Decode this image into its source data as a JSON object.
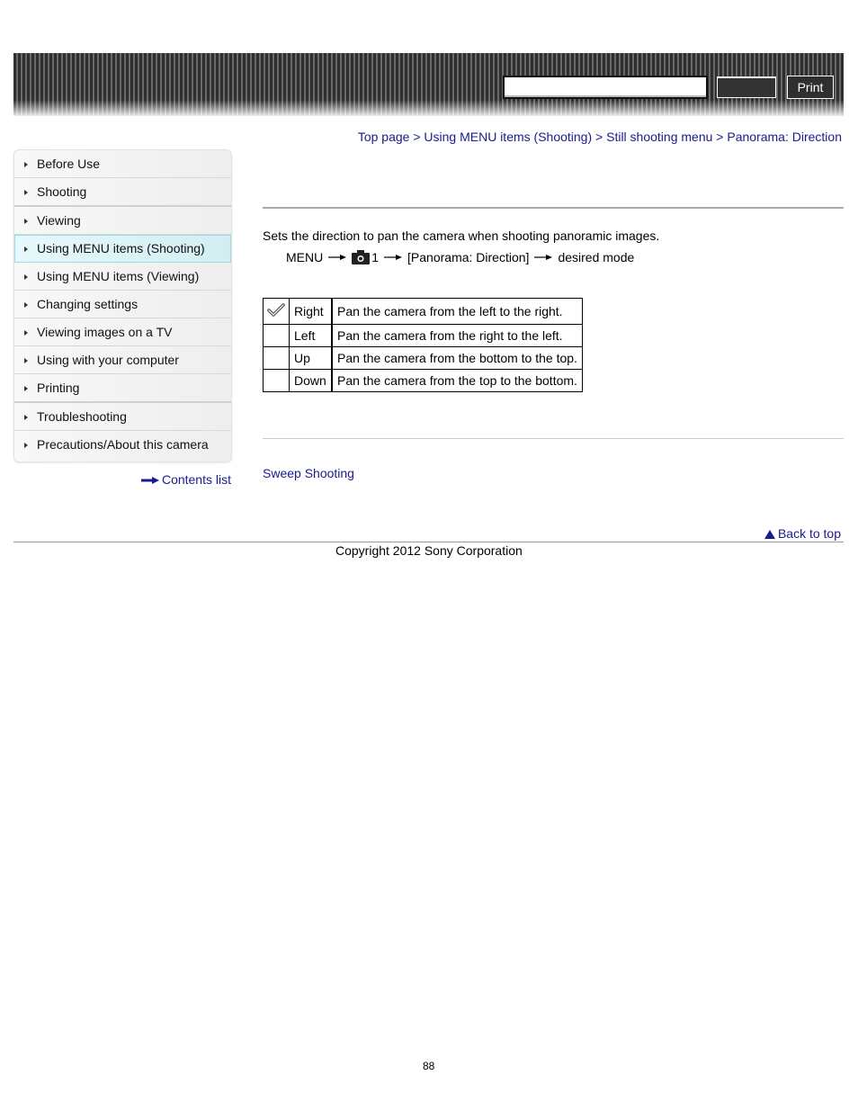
{
  "header": {
    "search_value": "",
    "search_button_label": "",
    "print_label": "Print"
  },
  "breadcrumb": [
    {
      "label": "Top page"
    },
    {
      "label": "Using MENU items (Shooting)"
    },
    {
      "label": "Still shooting menu"
    },
    {
      "label": "Panorama: Direction"
    }
  ],
  "breadcrumb_separator": ">",
  "sidebar": {
    "items": [
      {
        "label": "Before Use"
      },
      {
        "label": "Shooting"
      },
      {
        "label": "Viewing"
      },
      {
        "label": "Using MENU items (Shooting)",
        "active": true
      },
      {
        "label": "Using MENU items (Viewing)"
      },
      {
        "label": "Changing settings"
      },
      {
        "label": "Viewing images on a TV"
      },
      {
        "label": "Using with your computer"
      },
      {
        "label": "Printing"
      },
      {
        "label": "Troubleshooting"
      },
      {
        "label": "Precautions/About this camera"
      }
    ],
    "contents_link": "Contents list"
  },
  "main": {
    "intro": "Sets the direction to pan the camera when shooting panoramic images.",
    "menu_path": {
      "menu": "MENU",
      "camera_tab": "1",
      "item": "[Panorama: Direction]",
      "end": "desired mode"
    },
    "options": [
      {
        "default": true,
        "label": "Right",
        "description": "Pan the camera from the left to the right."
      },
      {
        "default": false,
        "label": "Left",
        "description": "Pan the camera from the right to the left."
      },
      {
        "default": false,
        "label": "Up",
        "description": "Pan the camera from the bottom to the top."
      },
      {
        "default": false,
        "label": "Down",
        "description": "Pan the camera from the top to the bottom."
      }
    ],
    "related_link": "Sweep Shooting"
  },
  "footer": {
    "back_to_top": "Back to top",
    "copyright": "Copyright 2012 Sony Corporation",
    "page_number": "88"
  },
  "colors": {
    "link": "#1a1a8c",
    "active_item_bg": "#d9f2f6"
  }
}
